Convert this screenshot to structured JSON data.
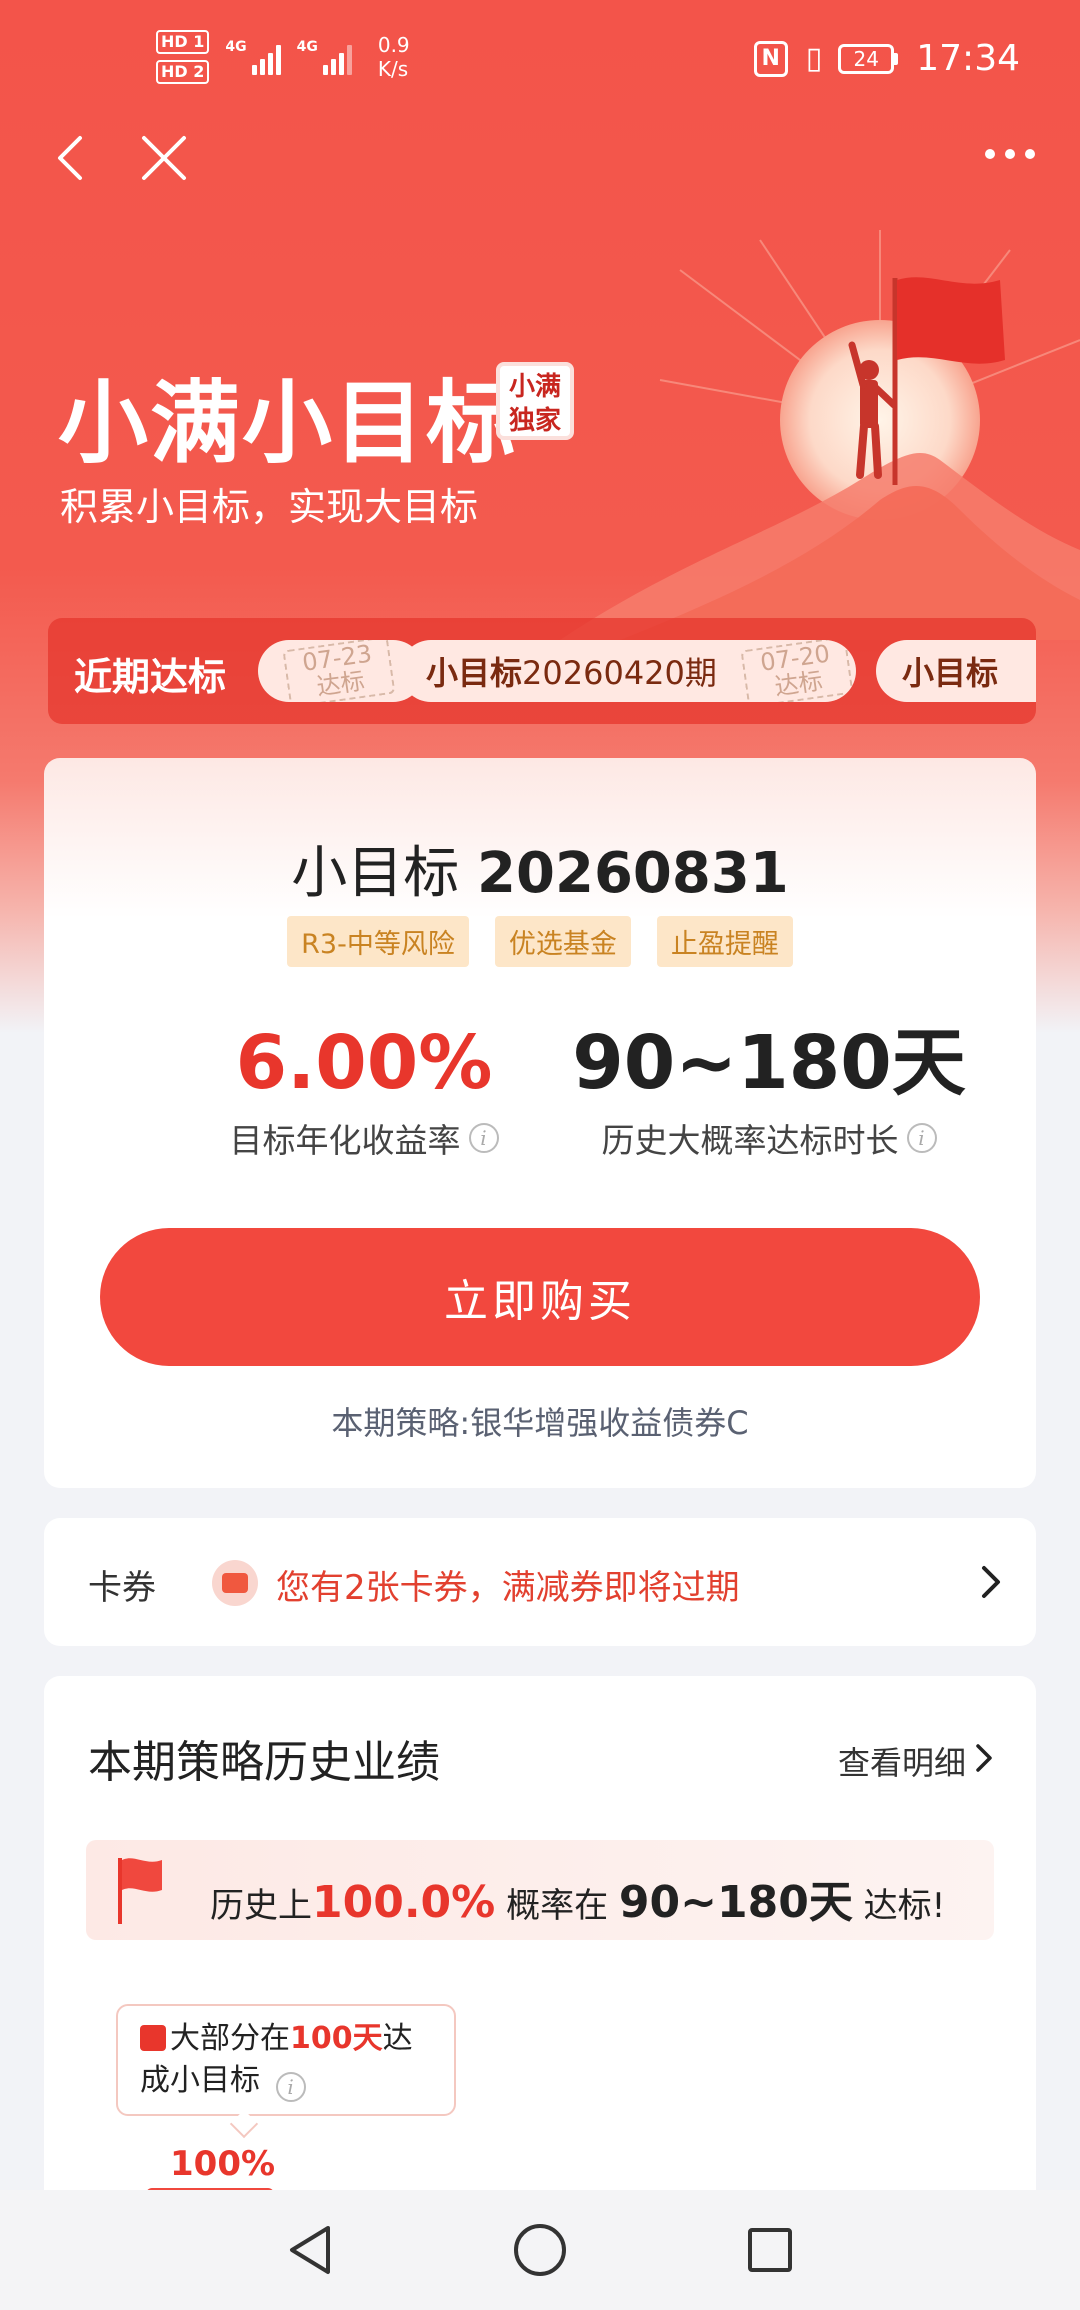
{
  "status_bar": {
    "hd1": "HD 1",
    "hd2": "HD 2",
    "sig1_label": "4G",
    "sig2_label": "4G",
    "net_speed_value": "0.9",
    "net_speed_unit": "K/s",
    "nfc": "N",
    "battery": "24",
    "time": "17:34"
  },
  "hero": {
    "title": "小满小目标",
    "badge_line1": "小满",
    "badge_line2": "独家",
    "subtitle": "积累小目标，实现大目标"
  },
  "recent": {
    "label": "近期达标",
    "stamp1_date": "07-23",
    "stamp1_text": "达标",
    "chip2_name": "小目标",
    "chip2_period": "20260420期",
    "stamp2_date": "07-20",
    "stamp2_text": "达标",
    "chip3_name": "小目标"
  },
  "product": {
    "title_prefix": "小目标",
    "title_number": "20260831",
    "tags": [
      "R3-中等风险",
      "优选基金",
      "止盈提醒"
    ],
    "rate_value": "6.00%",
    "rate_label": "目标年化收益率",
    "duration_value": "90~180天",
    "duration_label": "历史大概率达标时长",
    "buy_label": "立即购买",
    "strategy": "本期策略:银华增强收益债券C"
  },
  "coupon": {
    "label": "卡券",
    "text": "您有2张卡券，满减券即将过期"
  },
  "history": {
    "title": "本期策略历史业绩",
    "more_label": "查看明细",
    "banner_pre": "历史上",
    "banner_rate": "100.0%",
    "banner_mid": "概率在",
    "banner_days": "90~180天",
    "banner_post": "达标!",
    "tip_pre": "大部分在",
    "tip_days": "100天",
    "tip_post1": "达",
    "tip_post2": "成小目标",
    "bar_value_label": "100%",
    "bar_value": 100
  },
  "colors": {
    "brand_red": "#f2483e",
    "accent_red": "#e8362c",
    "tag_bg": "#fde6c8",
    "tag_text": "#c98322"
  }
}
